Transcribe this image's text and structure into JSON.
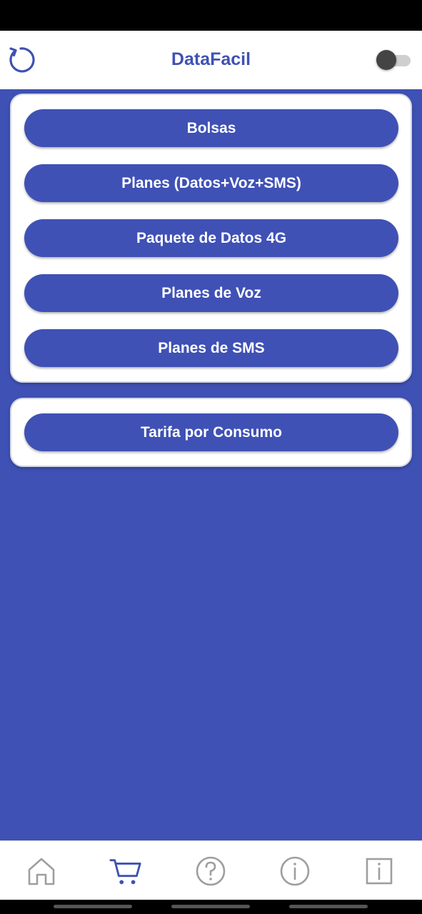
{
  "header": {
    "title": "DataFacil",
    "refresh_icon": "refresh-icon",
    "dark_mode_toggle": {
      "on": false
    }
  },
  "menu": {
    "items": [
      {
        "label": "Bolsas"
      },
      {
        "label": "Planes (Datos+Voz+SMS)"
      },
      {
        "label": "Paquete de Datos 4G"
      },
      {
        "label": "Planes de Voz"
      },
      {
        "label": "Planes de SMS"
      }
    ],
    "secondary": {
      "label": "Tarifa por Consumo"
    }
  },
  "bottom_nav": {
    "items": [
      {
        "icon": "home-icon",
        "active": false
      },
      {
        "icon": "cart-icon",
        "active": true
      },
      {
        "icon": "help-icon",
        "active": false
      },
      {
        "icon": "info-icon",
        "active": false
      },
      {
        "icon": "info-box-icon",
        "active": false
      }
    ]
  },
  "colors": {
    "primary": "#3f51b5",
    "surface": "#ffffff",
    "inactive_icon": "#9e9e9e"
  }
}
